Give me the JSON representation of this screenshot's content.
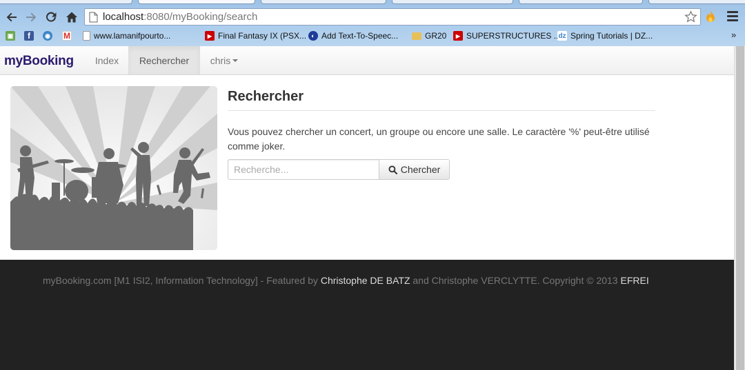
{
  "browser": {
    "url_host": "localhost",
    "url_path": ":8080/myBooking/search",
    "bookmarks": [
      {
        "label": "",
        "icon": "app-cube-icon",
        "color": "#6aa84f"
      },
      {
        "label": "",
        "icon": "facebook-icon",
        "color": "#3b5998"
      },
      {
        "label": "",
        "icon": "globe-icon",
        "color": "#3d85c6"
      },
      {
        "label": "",
        "icon": "gmail-icon",
        "color": "#d93025"
      },
      {
        "label": "www.lamanifpourto...",
        "icon": "page-icon",
        "color": "#ffffff"
      },
      {
        "label": "Final Fantasy IX (PSX...",
        "icon": "youtube-icon",
        "color": "#cc0000"
      },
      {
        "label": "Add Text-To-Speec...",
        "icon": "speech-icon",
        "color": "#1f3b99"
      },
      {
        "label": "GR20",
        "icon": "folder-icon",
        "color": "#e7c05a"
      },
      {
        "label": "SUPERSTRUCTURES ...",
        "icon": "youtube-icon",
        "color": "#cc0000"
      },
      {
        "label": "Spring Tutorials | DZ...",
        "icon": "dzone-icon",
        "color": "#3d85c6"
      }
    ],
    "more_label": "»"
  },
  "navbar": {
    "brand": "myBooking",
    "items": [
      {
        "label": "Index",
        "active": false
      },
      {
        "label": "Rechercher",
        "active": true
      },
      {
        "label": "chris",
        "active": false,
        "dropdown": true
      }
    ]
  },
  "main": {
    "title": "Rechercher",
    "description": "Vous pouvez chercher un concert, un groupe ou encore une salle. Le caractère '%' peut-être utilisé comme joker.",
    "search_placeholder": "Recherche...",
    "search_value": "",
    "search_button": "Chercher"
  },
  "footer": {
    "prefix": "myBooking.com [M1 ISI2, Information Technology] - Featured by ",
    "author1": "Christophe DE BATZ",
    "middle": " and Christophe VERCLYTTE. Copyright © 2013 ",
    "org": "EFREI"
  },
  "colors": {
    "brand": "#2c1b6e",
    "footer_bg": "#222222",
    "footer_highlight": "#dddddd"
  }
}
